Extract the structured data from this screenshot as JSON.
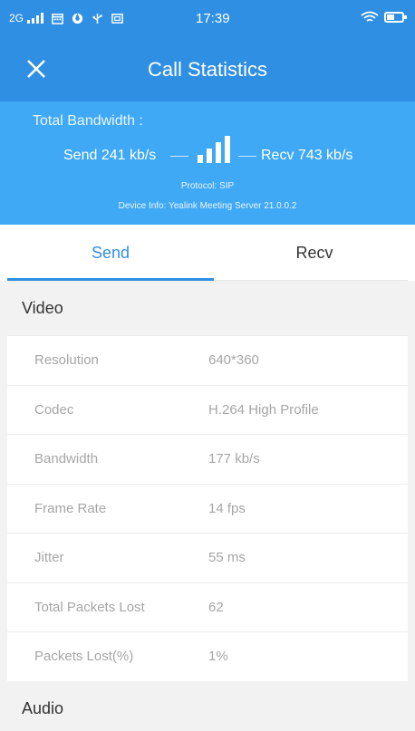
{
  "status_bar": {
    "network": "2G",
    "time": "17:39",
    "icons": [
      "signal-icon",
      "calendar-icon",
      "vpn-icon",
      "usb-icon",
      "screenshot-icon",
      "wifi-icon",
      "battery-icon"
    ]
  },
  "header": {
    "title": "Call Statistics",
    "close_icon": "close-icon"
  },
  "summary": {
    "bandwidth_label": "Total Bandwidth :",
    "send_rate": "Send 241 kb/s",
    "recv_rate": "Recv 743 kb/s",
    "protocol": "Protocol: SIP",
    "device_info": "Device Info: Yealink Meeting Server 21.0.0.2",
    "signal_strength_bars": 4
  },
  "tabs": [
    {
      "label": "Send",
      "active": true
    },
    {
      "label": "Recv",
      "active": false
    }
  ],
  "video": {
    "title": "Video",
    "rows": [
      {
        "label": "Resolution",
        "value": "640*360"
      },
      {
        "label": "Codec",
        "value": "H.264 High Profile"
      },
      {
        "label": "Bandwidth",
        "value": "177 kb/s"
      },
      {
        "label": "Frame Rate",
        "value": "14 fps"
      },
      {
        "label": "Jitter",
        "value": "55 ms"
      },
      {
        "label": "Total Packets Lost",
        "value": "62"
      },
      {
        "label": "Packets Lost(%)",
        "value": "1%"
      }
    ]
  },
  "audio": {
    "title": "Audio"
  },
  "colors": {
    "header_blue": "#2f8fe3",
    "summary_blue": "#3fa9f5",
    "active_tab": "#2f8fe3",
    "row_text": "#a6a6a6"
  }
}
